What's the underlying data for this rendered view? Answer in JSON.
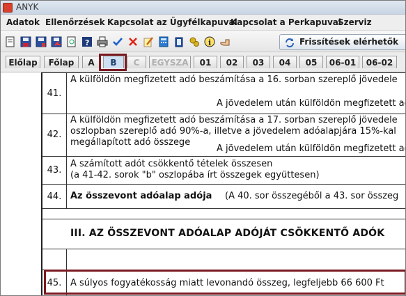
{
  "window": {
    "title": "ANYK"
  },
  "menu": [
    "Adatok",
    "Ellenőrzések",
    "Kapcsolat az Ügyfélkapuval",
    "Kapcsolat a Perkapuval",
    "Szerviz"
  ],
  "toolbar": {
    "icons": [
      "open-icon",
      "save-icon",
      "save-as-icon",
      "export-icon",
      "print-preview-icon",
      "help-icon",
      "print-icon",
      "check-icon",
      "delete-icon",
      "edit-icon",
      "calculator-icon",
      "clipboard-icon",
      "gears-icon",
      "info-icon",
      "hand-icon"
    ],
    "update_button_label": "Frissítések elérhetők"
  },
  "tabs": [
    "Előlap",
    "Főlap",
    "A",
    "B",
    "C",
    "EGYSZA",
    "01",
    "02",
    "03",
    "04",
    "05",
    "06-01",
    "06-02"
  ],
  "active_tab": "B",
  "disabled_tabs": [
    "C",
    "EGYSZA"
  ],
  "rows": {
    "r41": {
      "num": "41.",
      "line1": "A külföldön megfizetett adó beszámítása a 16. sorban szereplő jövedele",
      "line2": "A jövedelem után külföldön megfizetett ad"
    },
    "r42": {
      "num": "42.",
      "line1": "A külföldön megfizetett adó beszámítása a 17. sorban szereplő jövedele",
      "line2": "oszlopban szereplő adó 90%-a, illetve a jövedelem adóalapjára 15%-kal",
      "line3": "megállapított adó összege",
      "line4": "A jövedelem után külföldön megfizetett ad"
    },
    "r43": {
      "num": "43.",
      "line1": "A számított adót csökkentő tételek összesen",
      "line2": "(a 41-42. sorok \"b\" oszlopába írt összegek együttesen)"
    },
    "r44": {
      "num": "44.",
      "label": "Az összevont adóalap adója",
      "note": "(A 40. sor összegéből a 43. sor összeg"
    },
    "section": {
      "title": "III. AZ ÖSSZEVONT ADÓALAP ADÓJÁT CSÖKKENTŐ ADÓK"
    },
    "r45": {
      "num": "45.",
      "text": "A súlyos fogyatékosság miatt levonandó összeg, legfeljebb 66 600 Ft"
    }
  }
}
